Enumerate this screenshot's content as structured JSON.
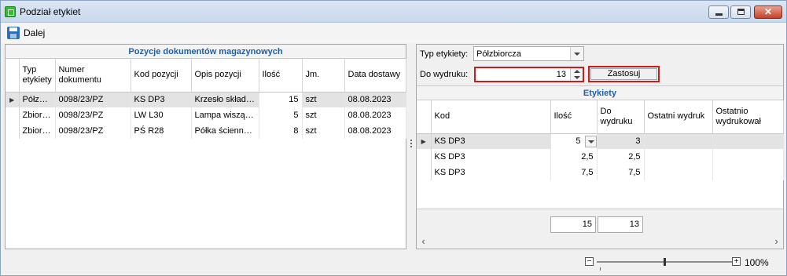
{
  "window": {
    "title": "Podział etykiet"
  },
  "toolbar": {
    "next_label": "Dalej"
  },
  "documents": {
    "title": "Pozycje dokumentów magazynowych",
    "columns": [
      "Typ etykiety",
      "Numer dokumentu",
      "Kod pozycji",
      "Opis pozycji",
      "Ilość",
      "Jm.",
      "Data dostawy"
    ],
    "rows": [
      [
        "Półzbi...",
        "0098/23/PZ",
        "KS DP3",
        "Krzesło składa...",
        "15",
        "szt",
        "08.08.2023"
      ],
      [
        "Zbiorcza",
        "0098/23/PZ",
        "LW L30",
        "Lampa wisząca...",
        "5",
        "szt",
        "08.08.2023"
      ],
      [
        "Zbiorcza",
        "0098/23/PZ",
        "PŚ R28",
        "Półka ścienna ...",
        "8",
        "szt",
        "08.08.2023"
      ]
    ]
  },
  "filter": {
    "type_label": "Typ etykiety:",
    "type_value": "Półzbiorcza",
    "print_label": "Do wydruku:",
    "print_value": "13",
    "apply_label": "Zastosuj"
  },
  "labels": {
    "title": "Etykiety",
    "columns": [
      "Kod",
      "Ilość",
      "Do wydruku",
      "Ostatni wydruk",
      "Ostatnio wydrukował"
    ],
    "rows": [
      [
        "KS DP3",
        "5",
        "3",
        "",
        ""
      ],
      [
        "KS DP3",
        "2,5",
        "2,5",
        "",
        ""
      ],
      [
        "KS DP3",
        "7,5",
        "7,5",
        "",
        ""
      ]
    ],
    "sum_qty": "15",
    "sum_print": "13"
  },
  "zoom": {
    "value": "100%",
    "level_percent": 100,
    "minus": "−",
    "plus": "+"
  },
  "colors": {
    "accent_title": "#1f5fa8",
    "highlight_border": "#d01a1a"
  }
}
